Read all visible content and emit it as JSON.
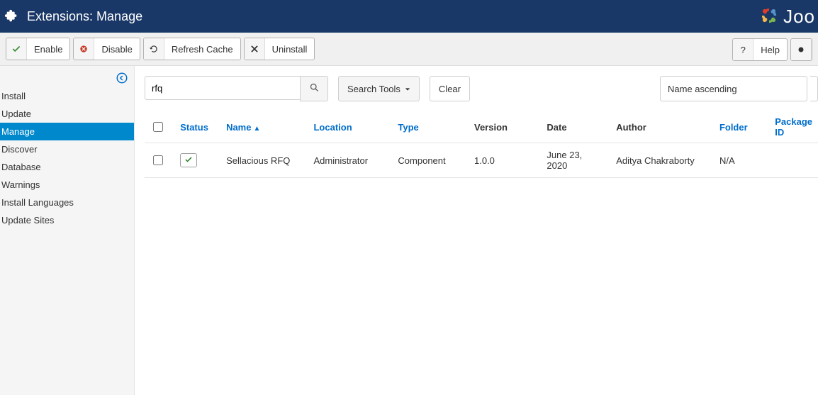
{
  "header": {
    "title": "Extensions: Manage",
    "brand": "Joo"
  },
  "toolbar": {
    "enable": "Enable",
    "disable": "Disable",
    "refresh_cache": "Refresh Cache",
    "uninstall": "Uninstall",
    "help": "Help"
  },
  "sidebar": {
    "items": [
      "Install",
      "Update",
      "Manage",
      "Discover",
      "Database",
      "Warnings",
      "Install Languages",
      "Update Sites"
    ],
    "active_index": 2
  },
  "filters": {
    "search_value": "rfq",
    "search_tools": "Search Tools",
    "clear": "Clear",
    "sort_selected": "Name ascending"
  },
  "table": {
    "headers": {
      "status": "Status",
      "name": "Name",
      "location": "Location",
      "type": "Type",
      "version": "Version",
      "date": "Date",
      "author": "Author",
      "folder": "Folder",
      "package_id": "Package ID"
    },
    "rows": [
      {
        "name": "Sellacious RFQ",
        "location": "Administrator",
        "type": "Component",
        "version": "1.0.0",
        "date": "June 23, 2020",
        "author": "Aditya Chakraborty",
        "folder": "N/A"
      }
    ]
  }
}
